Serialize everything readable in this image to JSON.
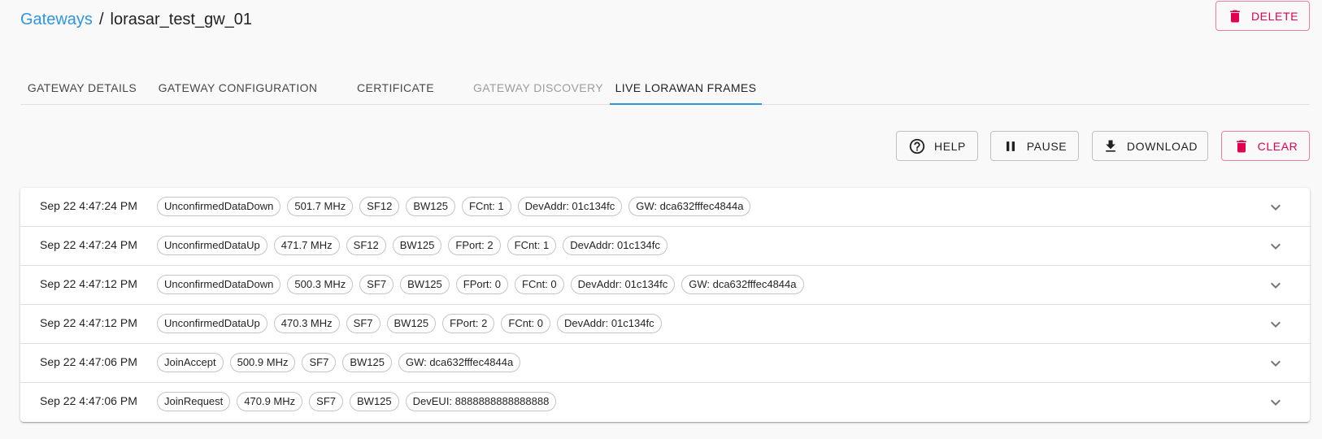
{
  "breadcrumb": {
    "parent": "Gateways",
    "separator": "/",
    "current": "lorasar_test_gw_01"
  },
  "header": {
    "delete_label": "Delete"
  },
  "tabs": [
    {
      "label": "Gateway Details",
      "state": "normal"
    },
    {
      "label": "Gateway Configuration",
      "state": "normal"
    },
    {
      "label": "Certificate",
      "state": "normal"
    },
    {
      "label": "Gateway Discovery",
      "state": "disabled"
    },
    {
      "label": "Live LoRaWAN Frames",
      "state": "active"
    }
  ],
  "toolbar": {
    "help_label": "Help",
    "pause_label": "Pause",
    "download_label": "Download",
    "clear_label": "Clear"
  },
  "colors": {
    "accent": "#2f95e2",
    "danger": "#e10050"
  },
  "frames": [
    {
      "time": "Sep 22 4:47:24 PM",
      "chips": [
        "UnconfirmedDataDown",
        "501.7 MHz",
        "SF12",
        "BW125",
        "FCnt: 1",
        "DevAddr: 01c134fc",
        "GW: dca632fffec4844a"
      ]
    },
    {
      "time": "Sep 22 4:47:24 PM",
      "chips": [
        "UnconfirmedDataUp",
        "471.7 MHz",
        "SF12",
        "BW125",
        "FPort: 2",
        "FCnt: 1",
        "DevAddr: 01c134fc"
      ]
    },
    {
      "time": "Sep 22 4:47:12 PM",
      "chips": [
        "UnconfirmedDataDown",
        "500.3 MHz",
        "SF7",
        "BW125",
        "FPort: 0",
        "FCnt: 0",
        "DevAddr: 01c134fc",
        "GW: dca632fffec4844a"
      ]
    },
    {
      "time": "Sep 22 4:47:12 PM",
      "chips": [
        "UnconfirmedDataUp",
        "470.3 MHz",
        "SF7",
        "BW125",
        "FPort: 2",
        "FCnt: 0",
        "DevAddr: 01c134fc"
      ]
    },
    {
      "time": "Sep 22 4:47:06 PM",
      "chips": [
        "JoinAccept",
        "500.9 MHz",
        "SF7",
        "BW125",
        "GW: dca632fffec4844a"
      ]
    },
    {
      "time": "Sep 22 4:47:06 PM",
      "chips": [
        "JoinRequest",
        "470.9 MHz",
        "SF7",
        "BW125",
        "DevEUI: 8888888888888888"
      ]
    }
  ]
}
